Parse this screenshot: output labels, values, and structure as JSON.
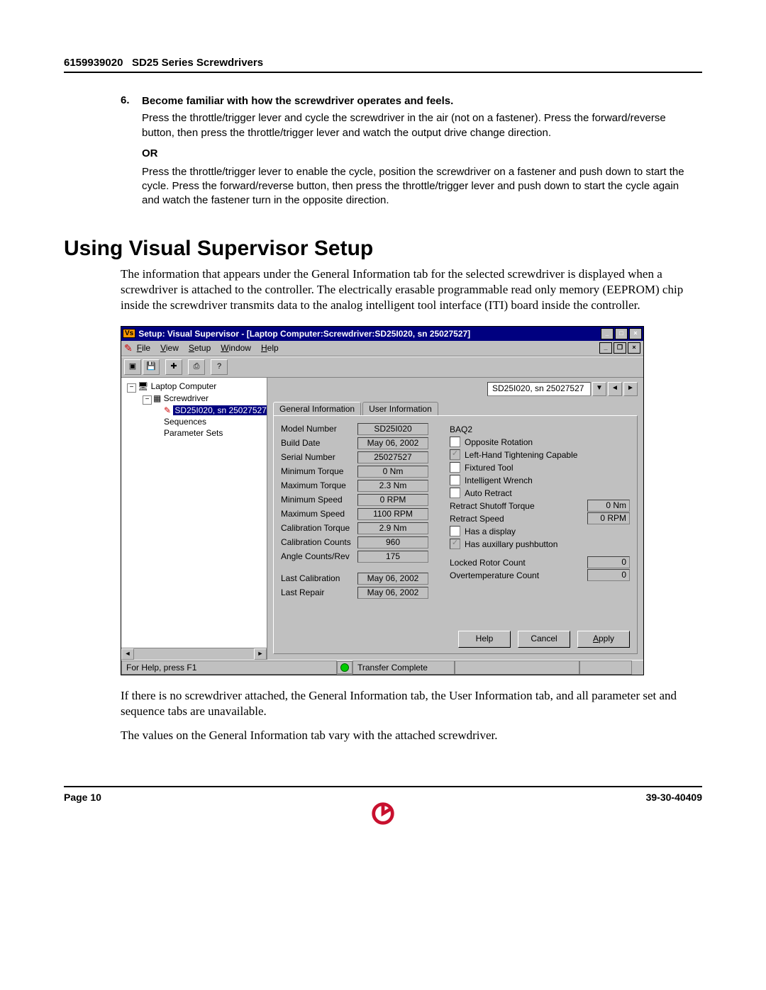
{
  "header": {
    "doc_number": "6159939020",
    "doc_title": "SD25 Series Screwdrivers"
  },
  "step6": {
    "number": "6.",
    "title": "Become familiar with how the screwdriver operates and feels.",
    "para1": "Press the throttle/trigger lever and cycle the screwdriver in the air (not on a fastener). Press the forward/reverse button, then press the throttle/trigger lever and watch the output drive change direction.",
    "or": "OR",
    "para2": "Press the throttle/trigger lever to enable the cycle, position the screwdriver on a fastener and push down to start the cycle. Press the forward/reverse button, then press the throttle/trigger lever and push down to start the cycle again and watch the fastener turn in the opposite direction."
  },
  "section_heading": "Using Visual Supervisor Setup",
  "section_intro": "The information that appears under the General Information tab for the selected screwdriver is displayed when a screwdriver is attached to the controller. The electrically erasable programmable read only memory (EEPROM) chip inside the screwdriver transmits data to the analog intelligent tool interface (ITI) board inside the controller.",
  "post_text1": "If there is no screwdriver attached, the General Information tab, the User Information tab, and all parameter set and sequence tabs are unavailable.",
  "post_text2": "The values on the General Information tab vary with the attached screwdriver.",
  "win": {
    "title": "Setup: Visual Supervisor - [Laptop Computer:Screwdriver:SD25I020, sn 25027527]",
    "menus": {
      "file": "File",
      "view": "View",
      "setup": "Setup",
      "window": "Window",
      "help": "Help"
    },
    "tree": {
      "root": "Laptop Computer",
      "screwdriver": "Screwdriver",
      "selected": "SD25I020, sn 25027527",
      "sequences": "Sequences",
      "paramsets": "Parameter Sets"
    },
    "selector_value": "SD25I020, sn 25027527",
    "tabs": {
      "general": "General Information",
      "user": "User Information"
    },
    "left_fields": [
      {
        "label": "Model Number",
        "value": "SD25I020"
      },
      {
        "label": "Build Date",
        "value": "May 06, 2002"
      },
      {
        "label": "Serial Number",
        "value": "25027527"
      },
      {
        "label": "Minimum Torque",
        "value": "0 Nm"
      },
      {
        "label": "Maximum Torque",
        "value": "2.3 Nm"
      },
      {
        "label": "Minimum Speed",
        "value": "0 RPM"
      },
      {
        "label": "Maximum Speed",
        "value": "1100 RPM"
      },
      {
        "label": "Calibration Torque",
        "value": "2.9 Nm"
      },
      {
        "label": "Calibration Counts",
        "value": "960"
      },
      {
        "label": "Angle Counts/Rev",
        "value": "175"
      }
    ],
    "left_fields2": [
      {
        "label": "Last Calibration",
        "value": "May 06, 2002"
      },
      {
        "label": "Last Repair",
        "value": "May 06, 2002"
      }
    ],
    "right_header": "BAQ2",
    "right_checks": [
      {
        "label": "Opposite Rotation",
        "checked": false,
        "gray": false
      },
      {
        "label": "Left-Hand Tightening Capable",
        "checked": true,
        "gray": true
      },
      {
        "label": "Fixtured Tool",
        "checked": false,
        "gray": false
      },
      {
        "label": "Intelligent Wrench",
        "checked": false,
        "gray": false
      },
      {
        "label": "Auto Retract",
        "checked": false,
        "gray": false
      }
    ],
    "right_vals": [
      {
        "label": "Retract Shutoff Torque",
        "value": "0 Nm"
      },
      {
        "label": "Retract Speed",
        "value": "0 RPM"
      }
    ],
    "right_checks2": [
      {
        "label": "Has a display",
        "checked": false,
        "gray": false
      },
      {
        "label": "Has auxillary pushbutton",
        "checked": true,
        "gray": true
      }
    ],
    "right_counts": [
      {
        "label": "Locked Rotor Count",
        "value": "0"
      },
      {
        "label": "Overtemperature Count",
        "value": "0"
      }
    ],
    "buttons": {
      "help": "Help",
      "cancel": "Cancel",
      "apply": "Apply"
    },
    "status": {
      "f1": "For Help, press F1",
      "transfer": "Transfer Complete"
    }
  },
  "footer": {
    "page": "Page 10",
    "code": "39-30-40409"
  }
}
